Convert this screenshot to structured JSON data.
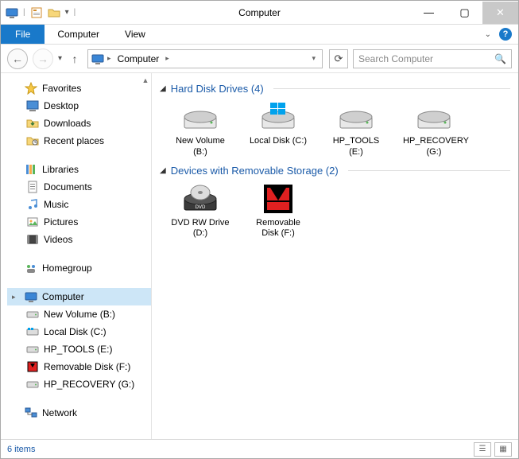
{
  "window": {
    "title": "Computer",
    "min_tooltip": "Minimize",
    "max_tooltip": "Maximize",
    "close_tooltip": "Close"
  },
  "ribbon": {
    "file": "File",
    "tabs": [
      "Computer",
      "View"
    ]
  },
  "nav": {
    "back": "Back",
    "forward": "Forward",
    "up": "Up",
    "breadcrumb_root": "Computer",
    "refresh": "Refresh",
    "search_placeholder": "Search Computer"
  },
  "tree": {
    "favorites": {
      "label": "Favorites",
      "items": [
        "Desktop",
        "Downloads",
        "Recent places"
      ]
    },
    "libraries": {
      "label": "Libraries",
      "items": [
        "Documents",
        "Music",
        "Pictures",
        "Videos"
      ]
    },
    "homegroup": {
      "label": "Homegroup"
    },
    "computer": {
      "label": "Computer",
      "items": [
        "New Volume (B:)",
        "Local Disk (C:)",
        "HP_TOOLS (E:)",
        "Removable Disk (F:)",
        "HP_RECOVERY (G:)"
      ]
    },
    "network": {
      "label": "Network"
    }
  },
  "groups": [
    {
      "title": "Hard Disk Drives (4)",
      "items": [
        {
          "label": "New Volume (B:)",
          "icon": "hdd"
        },
        {
          "label": "Local Disk (C:)",
          "icon": "hdd-win"
        },
        {
          "label": "HP_TOOLS (E:)",
          "icon": "hdd"
        },
        {
          "label": "HP_RECOVERY (G:)",
          "icon": "hdd"
        }
      ]
    },
    {
      "title": "Devices with Removable Storage (2)",
      "items": [
        {
          "label": "DVD RW Drive (D:)",
          "icon": "dvd"
        },
        {
          "label": "Removable Disk (F:)",
          "icon": "removable"
        }
      ]
    }
  ],
  "status": {
    "text": "6 items"
  }
}
